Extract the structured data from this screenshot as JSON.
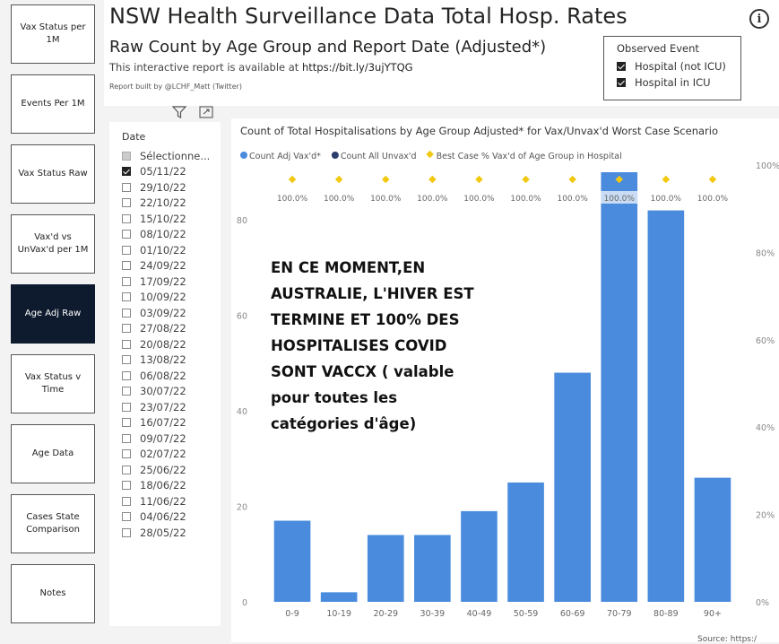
{
  "nav": [
    {
      "label": "Vax Status per 1M",
      "active": false
    },
    {
      "label": "Events Per 1M",
      "active": false
    },
    {
      "label": "Vax Status Raw",
      "active": false
    },
    {
      "label": "Vax'd vs UnVax'd per 1M",
      "active": false
    },
    {
      "label": "Age Adj Raw",
      "active": true
    },
    {
      "label": "Vax Status v Time",
      "active": false
    },
    {
      "label": "Age Data",
      "active": false
    },
    {
      "label": "Cases State Comparison",
      "active": false
    },
    {
      "label": "Notes",
      "active": false
    }
  ],
  "header": {
    "title": "NSW Health Surveillance Data Total Hosp. Rates",
    "subtitle": "Raw Count by Age Group and Report Date (Adjusted*)",
    "note_prefix": "This interactive report is available at ",
    "note_link": "https://bit.ly/3ujYTQG",
    "built_by": "Report built by @LCHF_Matt (Twitter)",
    "info_icon": "i"
  },
  "observed_event": {
    "title": "Observed Event",
    "options": [
      {
        "label": "Hospital (not ICU)",
        "checked": true
      },
      {
        "label": "Hospital in ICU",
        "checked": true
      }
    ]
  },
  "date_slicer": {
    "label": "Date",
    "select_all": "Sélectionne...",
    "dates": [
      {
        "label": "05/11/22",
        "checked": true
      },
      {
        "label": "29/10/22",
        "checked": false
      },
      {
        "label": "22/10/22",
        "checked": false
      },
      {
        "label": "15/10/22",
        "checked": false
      },
      {
        "label": "08/10/22",
        "checked": false
      },
      {
        "label": "01/10/22",
        "checked": false
      },
      {
        "label": "24/09/22",
        "checked": false
      },
      {
        "label": "17/09/22",
        "checked": false
      },
      {
        "label": "10/09/22",
        "checked": false
      },
      {
        "label": "03/09/22",
        "checked": false
      },
      {
        "label": "27/08/22",
        "checked": false
      },
      {
        "label": "20/08/22",
        "checked": false
      },
      {
        "label": "13/08/22",
        "checked": false
      },
      {
        "label": "06/08/22",
        "checked": false
      },
      {
        "label": "30/07/22",
        "checked": false
      },
      {
        "label": "23/07/22",
        "checked": false
      },
      {
        "label": "16/07/22",
        "checked": false
      },
      {
        "label": "09/07/22",
        "checked": false
      },
      {
        "label": "02/07/22",
        "checked": false
      },
      {
        "label": "25/06/22",
        "checked": false
      },
      {
        "label": "18/06/22",
        "checked": false
      },
      {
        "label": "11/06/22",
        "checked": false
      },
      {
        "label": "04/06/22",
        "checked": false
      },
      {
        "label": "28/05/22",
        "checked": false
      }
    ]
  },
  "chart_data": {
    "type": "bar",
    "title": "Count of Total Hospitalisations by Age Group Adjusted* for Vax/Unvax'd Worst Case Scenario",
    "categories": [
      "0-9",
      "10-19",
      "20-29",
      "30-39",
      "40-49",
      "50-59",
      "60-69",
      "70-79",
      "80-89",
      "90+"
    ],
    "series": [
      {
        "name": "Count Adj Vax'd*",
        "color": "#4a8bde",
        "values": [
          17,
          2,
          14,
          14,
          19,
          25,
          48,
          90,
          82,
          26
        ]
      },
      {
        "name": "Count All Unvax'd",
        "color": "#2c3e6b",
        "values": [
          0,
          0,
          0,
          0,
          0,
          0,
          0,
          0,
          0,
          0
        ]
      },
      {
        "name": "Best Case % Vax'd of Age Group in Hospital",
        "color": "#f2c811",
        "values": [
          100,
          100,
          100,
          100,
          100,
          100,
          100,
          100,
          100,
          100
        ],
        "axis": "right",
        "labels": [
          "100.0%",
          "100.0%",
          "100.0%",
          "100.0%",
          "100.0%",
          "100.0%",
          "100.0%",
          "100.0%",
          "100.0%",
          "100.0%"
        ]
      }
    ],
    "y_ticks": [
      0,
      20,
      40,
      60,
      80
    ],
    "ylim": [
      0,
      90
    ],
    "y2_ticks": [
      "0%",
      "20%",
      "40%",
      "60%",
      "80%",
      "100%"
    ],
    "y2lim": [
      0,
      100
    ],
    "legend_position": "top-left",
    "grid": false
  },
  "overlay_text": [
    "EN CE MOMENT,EN",
    "AUSTRALIE, L'HIVER  EST",
    "TERMINE ET 100% DES",
    "HOSPITALISES COVID",
    "SONT VACCX  ( valable",
    "pour toutes les",
    "catégories d'âge)"
  ],
  "source_text": "Source: https:/"
}
